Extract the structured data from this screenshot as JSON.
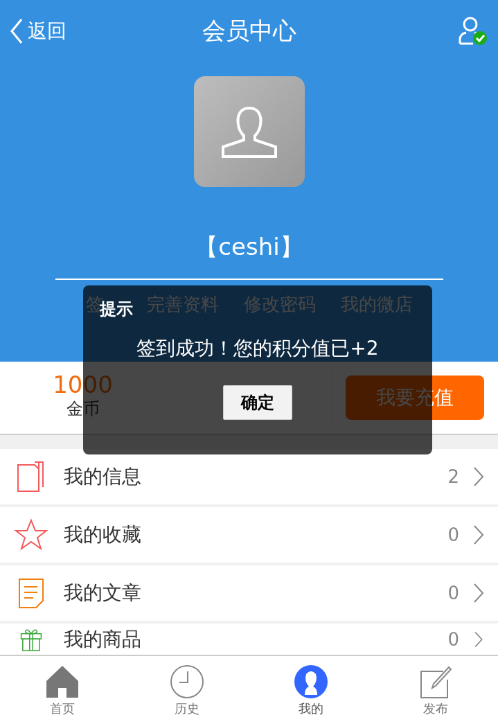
{
  "nav_bar": {
    "back": "返回",
    "title": "会员中心",
    "account_verified": true
  },
  "profile": {
    "name": "【ceshi】"
  },
  "actions": [
    "签",
    "完善资料",
    "修改密码",
    "我的微店"
  ],
  "stats": [
    {
      "value": "1000",
      "label": "金币"
    }
  ],
  "recharge_button": "我要充值",
  "menu": [
    {
      "kind": "messages",
      "label": "我的信息",
      "count": "2"
    },
    {
      "kind": "favorites",
      "label": "我的收藏",
      "count": "0"
    },
    {
      "kind": "articles",
      "label": "我的文章",
      "count": "0"
    },
    {
      "kind": "goods",
      "label": "我的商品",
      "count": "0"
    }
  ],
  "tab_bar": [
    {
      "kind": "home",
      "label": "首页",
      "selected": false
    },
    {
      "kind": "history",
      "label": "历史",
      "selected": false
    },
    {
      "kind": "me",
      "label": "我的",
      "selected": true
    },
    {
      "kind": "publish",
      "label": "发布",
      "selected": false
    }
  ],
  "dialog": {
    "title": "提示",
    "message": "签到成功！您的积分值已+2",
    "button": "确定"
  }
}
